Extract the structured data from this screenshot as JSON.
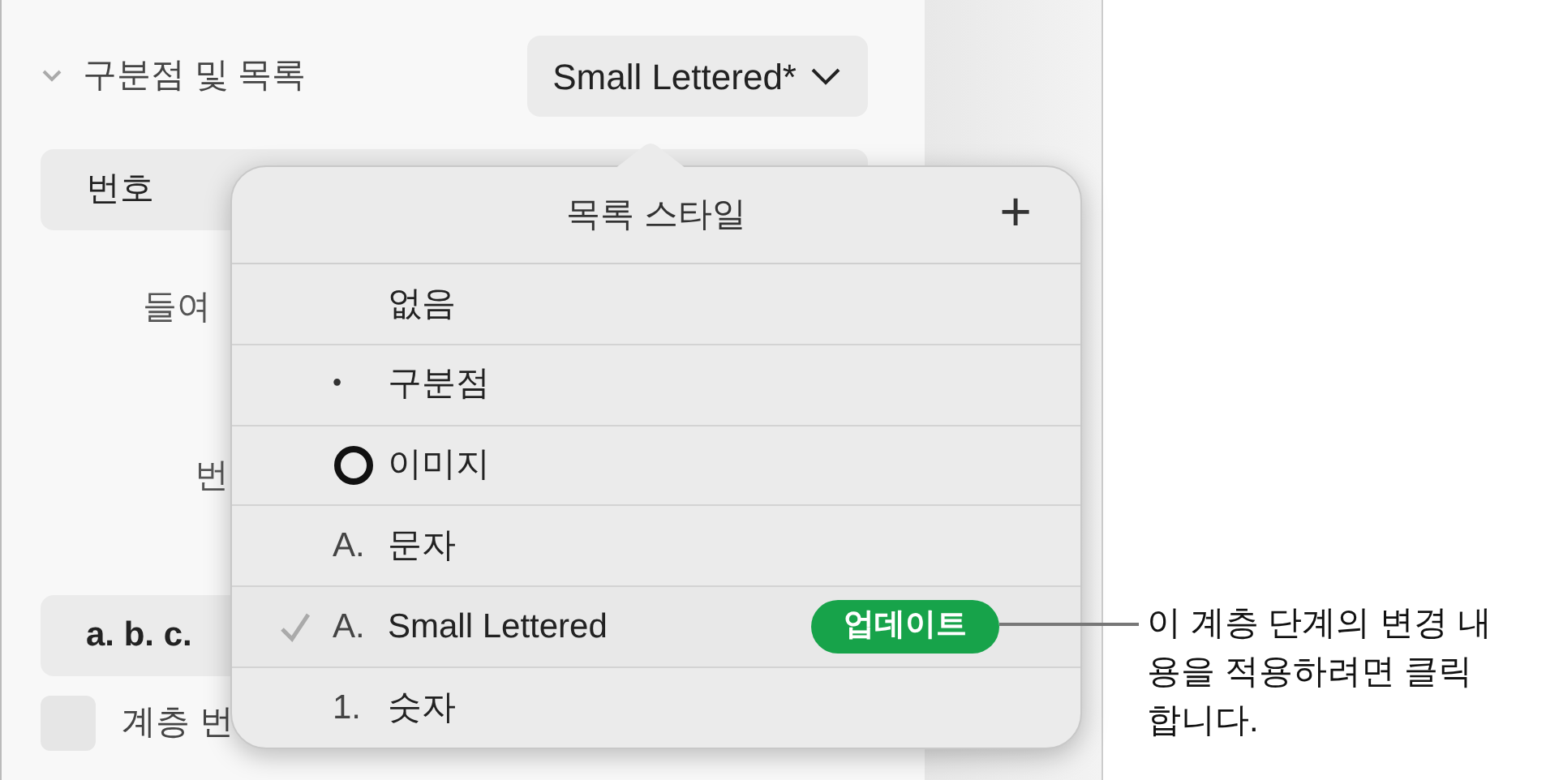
{
  "sidebar": {
    "section_title": "구분점 및 목록",
    "expanded": true,
    "style_button": "Small Lettered*",
    "number_bar": "번호",
    "label_1": "들여",
    "label_2": "번",
    "format_bar": "a. b. c.",
    "checkbox": {
      "label": "계층 번",
      "checked": false
    }
  },
  "popover": {
    "title": "목록 스타일",
    "add_button": "+",
    "items": [
      {
        "kind": "none",
        "label": "없음",
        "selected": false
      },
      {
        "kind": "bullet",
        "marker": "•",
        "label": "구분점",
        "selected": false
      },
      {
        "kind": "image",
        "label": "이미지",
        "selected": false
      },
      {
        "kind": "text",
        "marker": "A.",
        "label": "문자",
        "selected": false
      },
      {
        "kind": "text",
        "marker": "A.",
        "label": "Small Lettered",
        "selected": true,
        "update_button": "업데이트"
      },
      {
        "kind": "text",
        "marker": "1.",
        "label": "숫자",
        "selected": false
      }
    ]
  },
  "callout": "이 계층 단계의 변경 내용을 적용하려면 클릭합니다."
}
